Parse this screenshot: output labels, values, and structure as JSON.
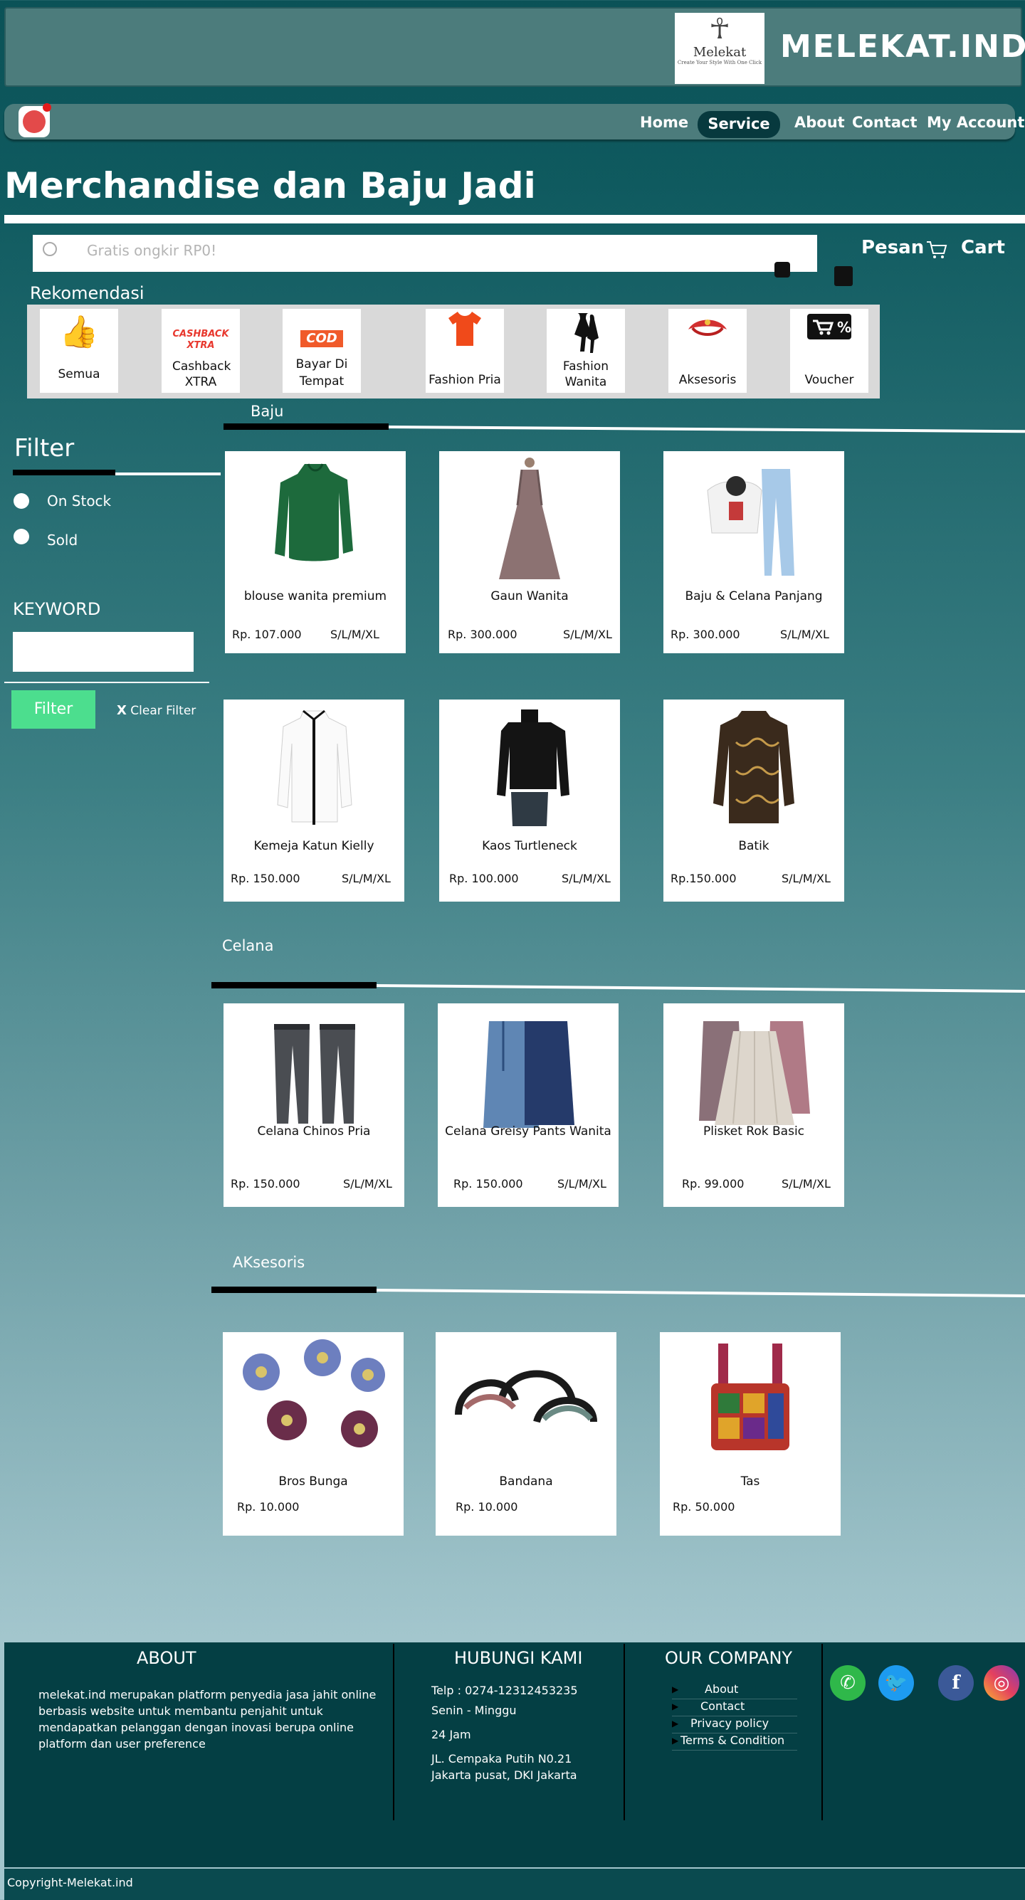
{
  "header": {
    "logo_mark": "☥",
    "logo_name": "Melekat",
    "logo_tagline": "Create Your Style With One Click",
    "brand": "MELEKAT.IND"
  },
  "nav": {
    "items": [
      "Home",
      "Service",
      "About",
      "Contact",
      "My Account"
    ],
    "active": "Service"
  },
  "page_title": "Merchandise dan Baju Jadi",
  "search": {
    "placeholder": "Gratis ongkir RP0!"
  },
  "actions": {
    "pesan": "Pesan",
    "cart": "Cart"
  },
  "recommend": {
    "title": "Rekomendasi",
    "categories": [
      {
        "label": "Semua",
        "icon": "thumbs-up-icon"
      },
      {
        "label": "Cashback XTRA",
        "icon": "cashback-xtra-icon",
        "icon_text": "CASHBACK XTRA"
      },
      {
        "label": "Bayar Di Tempat",
        "icon": "cod-icon",
        "icon_text": "COD"
      },
      {
        "label": "Fashion Pria",
        "icon": "tshirt-icon"
      },
      {
        "label": "Fashion Wanita",
        "icon": "dress-icon"
      },
      {
        "label": "Aksesoris",
        "icon": "accessory-icon"
      },
      {
        "label": "Voucher",
        "icon": "voucher-icon"
      }
    ]
  },
  "filter": {
    "title": "Filter",
    "options": [
      "On Stock",
      "Sold"
    ],
    "keyword_title": "KEYWORD",
    "button": "Filter",
    "clear_icon": "X",
    "clear": "Clear Filter"
  },
  "sections": {
    "baju": {
      "title": "Baju",
      "products": [
        {
          "name": "blouse wanita premium",
          "price": "Rp. 107.000",
          "size": "S/L/M/XL"
        },
        {
          "name": "Gaun Wanita",
          "price": "Rp. 300.000",
          "size": "S/L/M/XL"
        },
        {
          "name": "Baju & Celana Panjang",
          "price": "Rp. 300.000",
          "size": "S/L/M/XL"
        },
        {
          "name": "Kemeja Katun Kielly",
          "price": "Rp. 150.000",
          "size": "S/L/M/XL"
        },
        {
          "name": "Kaos Turtleneck",
          "price": "Rp. 100.000",
          "size": "S/L/M/XL"
        },
        {
          "name": "Batik",
          "price": "Rp.150.000",
          "size": "S/L/M/XL"
        }
      ]
    },
    "celana": {
      "title": "Celana",
      "products": [
        {
          "name": "Celana Chinos Pria",
          "price": "Rp. 150.000",
          "size": "S/L/M/XL"
        },
        {
          "name": "Celana Greisy Pants Wanita",
          "price": "Rp. 150.000",
          "size": "S/L/M/XL"
        },
        {
          "name": "Plisket Rok Basic",
          "price": "Rp. 99.000",
          "size": "S/L/M/XL"
        }
      ]
    },
    "aksesoris": {
      "title": "AKsesoris",
      "products": [
        {
          "name": "Bros Bunga",
          "price": "Rp. 10.000"
        },
        {
          "name": "Bandana",
          "price": "Rp. 10.000"
        },
        {
          "name": "Tas",
          "price": "Rp. 50.000"
        }
      ]
    }
  },
  "footer": {
    "about_title": "ABOUT",
    "about_text": [
      "melekat.ind merupakan platform penyedia jasa jahit online",
      "berbasis website untuk membantu penjahit untuk",
      "mendapatkan pelanggan dengan inovasi berupa online",
      "platform dan user preference"
    ],
    "contact_title": "HUBUNGI KAMI",
    "contact": {
      "phone": "Telp  :  0274-12312453235",
      "days": "Senin - Minggu",
      "hours": "24 Jam",
      "address1": "JL. Cempaka Putih N0.21",
      "address2": "Jakarta pusat, DKI Jakarta"
    },
    "company_title": "OUR COMPANY",
    "company_links": [
      "About",
      "Contact",
      "Privacy policy",
      "Terms & Condition"
    ],
    "social": [
      "whatsapp-icon",
      "twitter-icon",
      "facebook-icon",
      "instagram-icon"
    ],
    "copyright": "Copyright-Melekat.ind"
  }
}
